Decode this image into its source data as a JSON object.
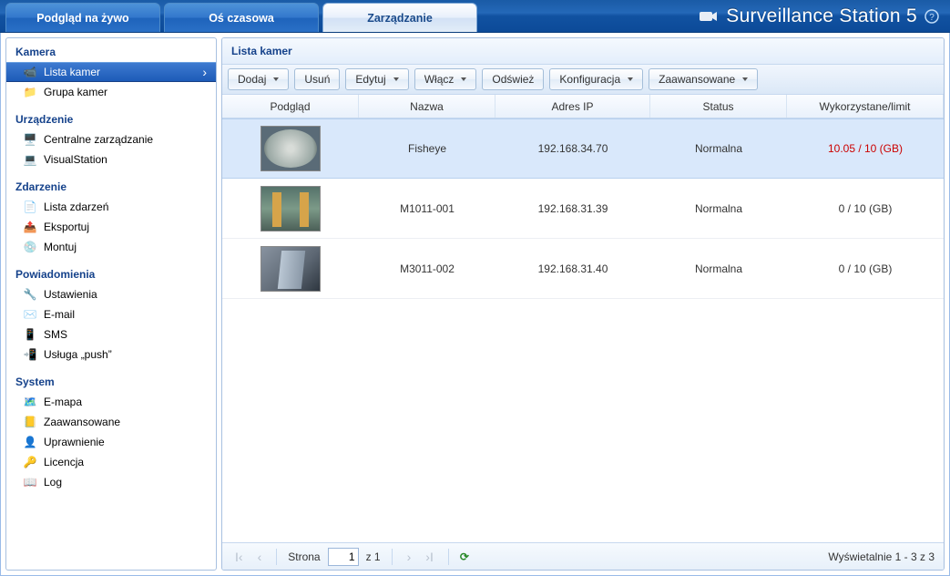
{
  "header": {
    "tabs": [
      {
        "label": "Podgląd na żywo",
        "active": false
      },
      {
        "label": "Oś czasowa",
        "active": false
      },
      {
        "label": "Zarządzanie",
        "active": true
      }
    ],
    "app_title": "Surveillance Station 5"
  },
  "sidebar": {
    "groups": [
      {
        "title": "Kamera",
        "items": [
          {
            "label": "Lista kamer",
            "selected": true,
            "icon": "camera-icon"
          },
          {
            "label": "Grupa kamer",
            "selected": false,
            "icon": "folder-camera-icon"
          }
        ]
      },
      {
        "title": "Urządzenie",
        "items": [
          {
            "label": "Centralne zarządzanie",
            "selected": false,
            "icon": "servers-icon"
          },
          {
            "label": "VisualStation",
            "selected": false,
            "icon": "monitor-icon"
          }
        ]
      },
      {
        "title": "Zdarzenie",
        "items": [
          {
            "label": "Lista zdarzeń",
            "selected": false,
            "icon": "list-icon"
          },
          {
            "label": "Eksportuj",
            "selected": false,
            "icon": "export-icon"
          },
          {
            "label": "Montuj",
            "selected": false,
            "icon": "mount-icon"
          }
        ]
      },
      {
        "title": "Powiadomienia",
        "items": [
          {
            "label": "Ustawienia",
            "selected": false,
            "icon": "settings-icon"
          },
          {
            "label": "E-mail",
            "selected": false,
            "icon": "mail-icon"
          },
          {
            "label": "SMS",
            "selected": false,
            "icon": "phone-icon"
          },
          {
            "label": "Usługa „push”",
            "selected": false,
            "icon": "push-icon"
          }
        ]
      },
      {
        "title": "System",
        "items": [
          {
            "label": "E-mapa",
            "selected": false,
            "icon": "emap-icon"
          },
          {
            "label": "Zaawansowane",
            "selected": false,
            "icon": "book-icon"
          },
          {
            "label": "Uprawnienie",
            "selected": false,
            "icon": "user-icon"
          },
          {
            "label": "Licencja",
            "selected": false,
            "icon": "key-icon"
          },
          {
            "label": "Log",
            "selected": false,
            "icon": "log-icon"
          }
        ]
      }
    ]
  },
  "panel": {
    "title": "Lista kamer",
    "toolbar": {
      "add": "Dodaj",
      "delete": "Usuń",
      "edit": "Edytuj",
      "enable": "Włącz",
      "refresh": "Odśwież",
      "config": "Konfiguracja",
      "advanced": "Zaawansowane"
    },
    "columns": {
      "preview": "Podgląd",
      "name": "Nazwa",
      "ip": "Adres IP",
      "status": "Status",
      "usage": "Wykorzystane/limit"
    },
    "rows": [
      {
        "name": "Fisheye",
        "ip": "192.168.34.70",
        "status": "Normalna",
        "usage": "10.05 / 10 (GB)",
        "usage_red": true,
        "selected": true,
        "thumb": "circ"
      },
      {
        "name": "M1011-001",
        "ip": "192.168.31.39",
        "status": "Normalna",
        "usage": "0 / 10 (GB)",
        "usage_red": false,
        "selected": false,
        "thumb": "hall"
      },
      {
        "name": "M3011-002",
        "ip": "192.168.31.40",
        "status": "Normalna",
        "usage": "0 / 10 (GB)",
        "usage_red": false,
        "selected": false,
        "thumb": "lobby"
      }
    ],
    "pager": {
      "page_label": "Strona",
      "page_value": "1",
      "of_label": "z 1",
      "info": "Wyświetalnie 1 - 3 z 3"
    }
  },
  "icons": {
    "camera-icon": "📹",
    "folder-camera-icon": "📁",
    "servers-icon": "🖥️",
    "monitor-icon": "💻",
    "list-icon": "📄",
    "export-icon": "📤",
    "mount-icon": "💿",
    "settings-icon": "🔧",
    "mail-icon": "✉️",
    "phone-icon": "📱",
    "push-icon": "📲",
    "emap-icon": "🗺️",
    "book-icon": "📒",
    "user-icon": "👤",
    "key-icon": "🔑",
    "log-icon": "📖"
  }
}
